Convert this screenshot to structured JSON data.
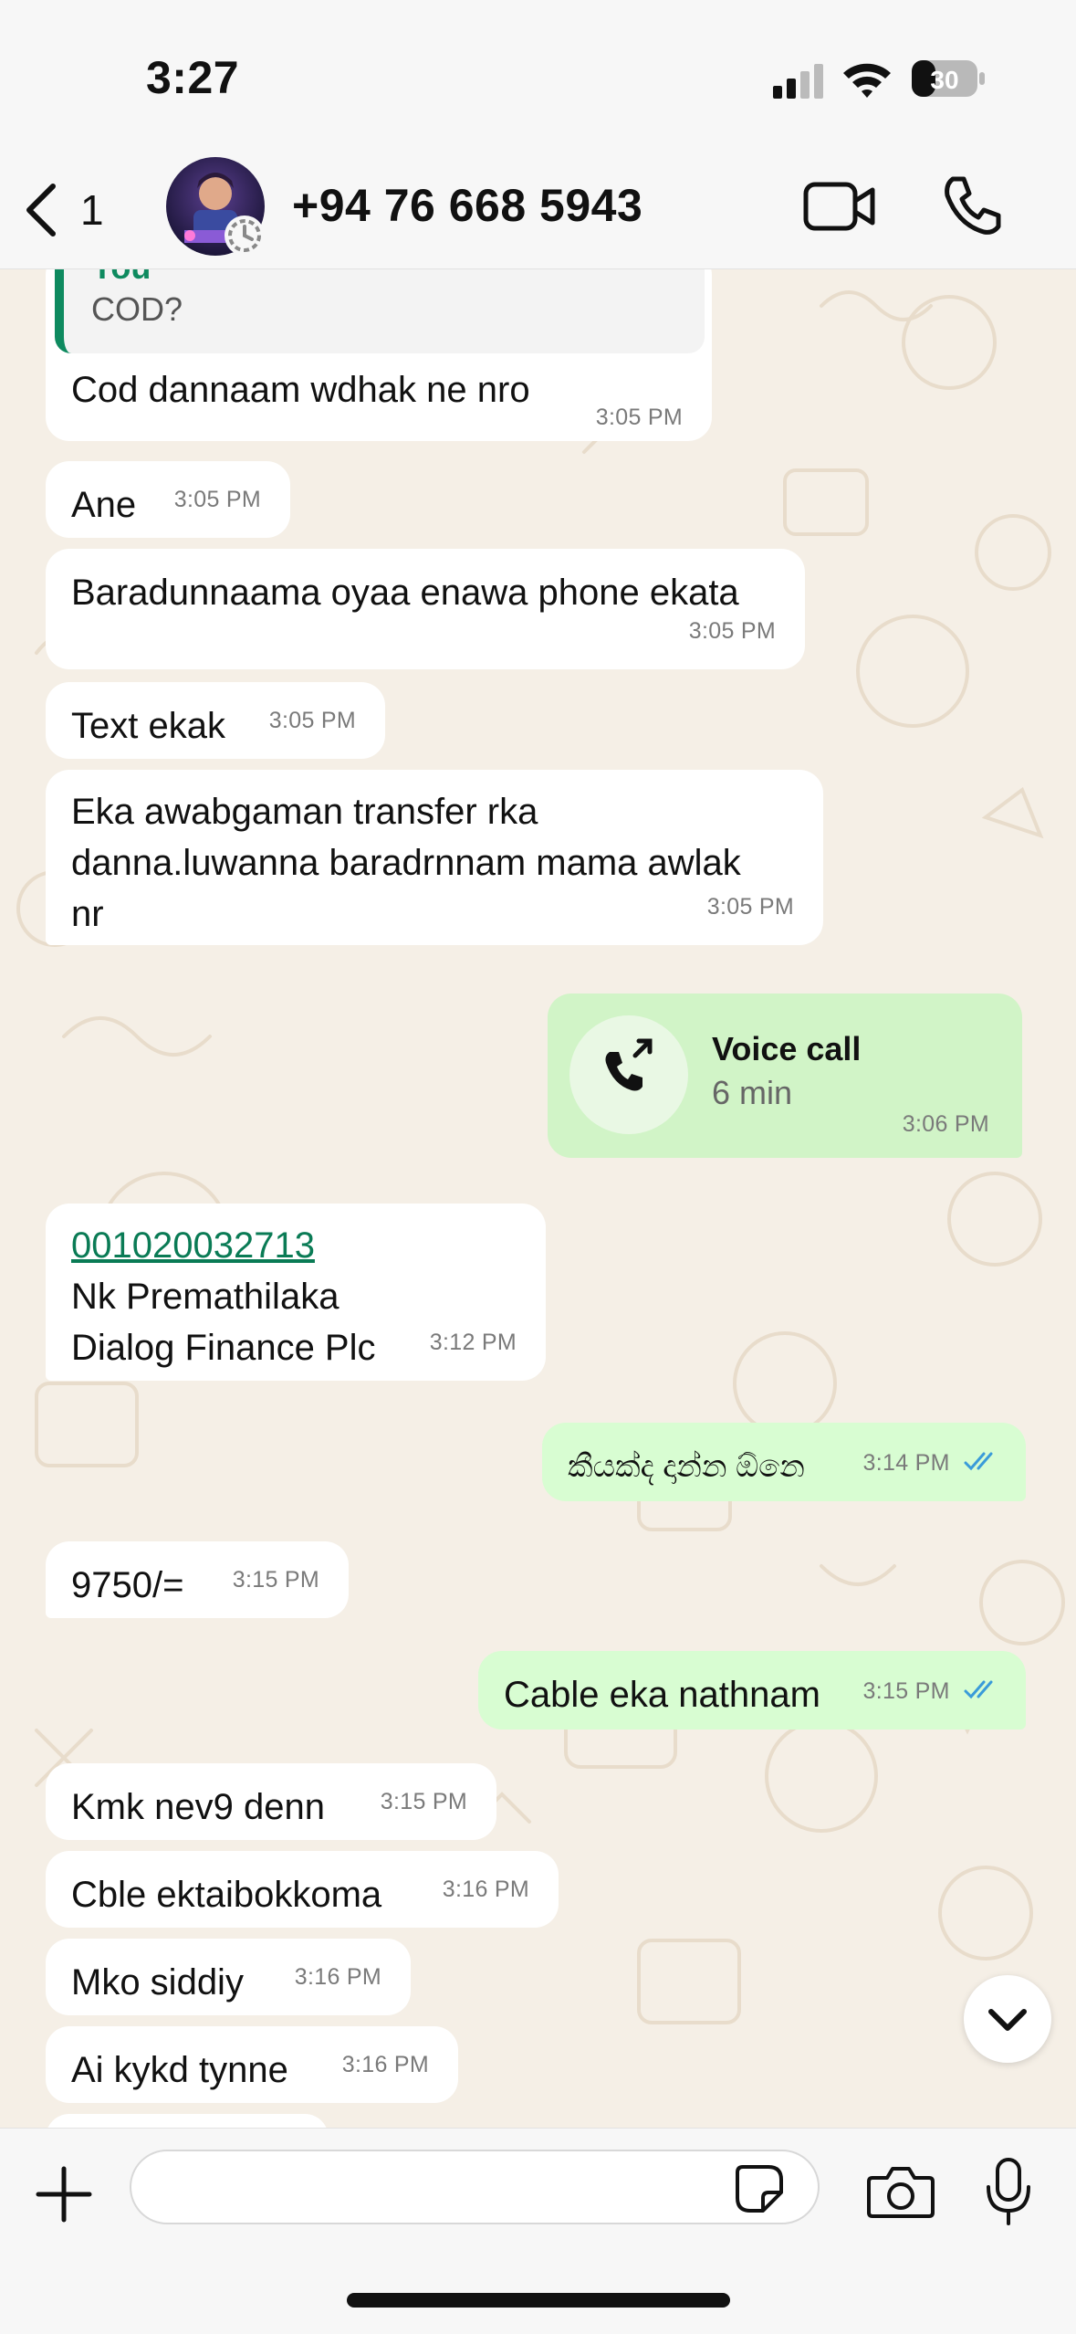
{
  "status_bar": {
    "time": "3:27",
    "battery": "30"
  },
  "header": {
    "back_count": "1",
    "contact_name": "+94 76 668 5943"
  },
  "quote": {
    "author": "You",
    "text": "COD?"
  },
  "messages": [
    {
      "text": "Cod dannaam wdhak ne nro",
      "time": "3:05 PM"
    },
    {
      "text": "Ane",
      "time": "3:05 PM"
    },
    {
      "text": "Baradunnaama oyaa enawa phone ekata",
      "time": "3:05 PM"
    },
    {
      "text": "Text ekak",
      "time": "3:05 PM"
    },
    {
      "lines": [
        "Eka awabgaman transfer rka",
        "danna.luwanna baradrnnam mama awlak",
        "nr"
      ],
      "time": "3:05 PM"
    },
    {
      "call_title": "Voice call",
      "call_duration": "6 min",
      "time": "3:06 PM"
    },
    {
      "link": "001020032713",
      "lines": [
        "Nk Premathilaka",
        "Dialog Finance Plc"
      ],
      "time": "3:12 PM"
    },
    {
      "text": "කීයක්ද දාන්න ඕනෙ",
      "time": "3:14 PM"
    },
    {
      "text": "9750/=",
      "time": "3:15 PM"
    },
    {
      "text": "Cable eka nathnam",
      "time": "3:15 PM"
    },
    {
      "text": "Kmk nev9 denn",
      "time": "3:15 PM"
    },
    {
      "text": "Cble ektaibokkoma",
      "time": "3:16 PM"
    },
    {
      "text": "Mko siddiy",
      "time": "3:16 PM"
    },
    {
      "text": "Ai kykd tynne",
      "time": "3:16 PM"
    }
  ],
  "composer": {
    "value": ""
  },
  "icons": {
    "back": "chevron-left-icon",
    "video": "video-camera-icon",
    "call": "phone-icon",
    "plus": "plus-icon",
    "sticker": "sticker-icon",
    "camera": "camera-icon",
    "mic": "microphone-icon",
    "scroll": "chevron-down-icon",
    "read": "double-check-icon"
  },
  "colors": {
    "outgoing": "#d8fdd2",
    "incoming": "#ffffff",
    "accent": "#0e8a5f",
    "read_ticks": "#3a9bd9"
  }
}
